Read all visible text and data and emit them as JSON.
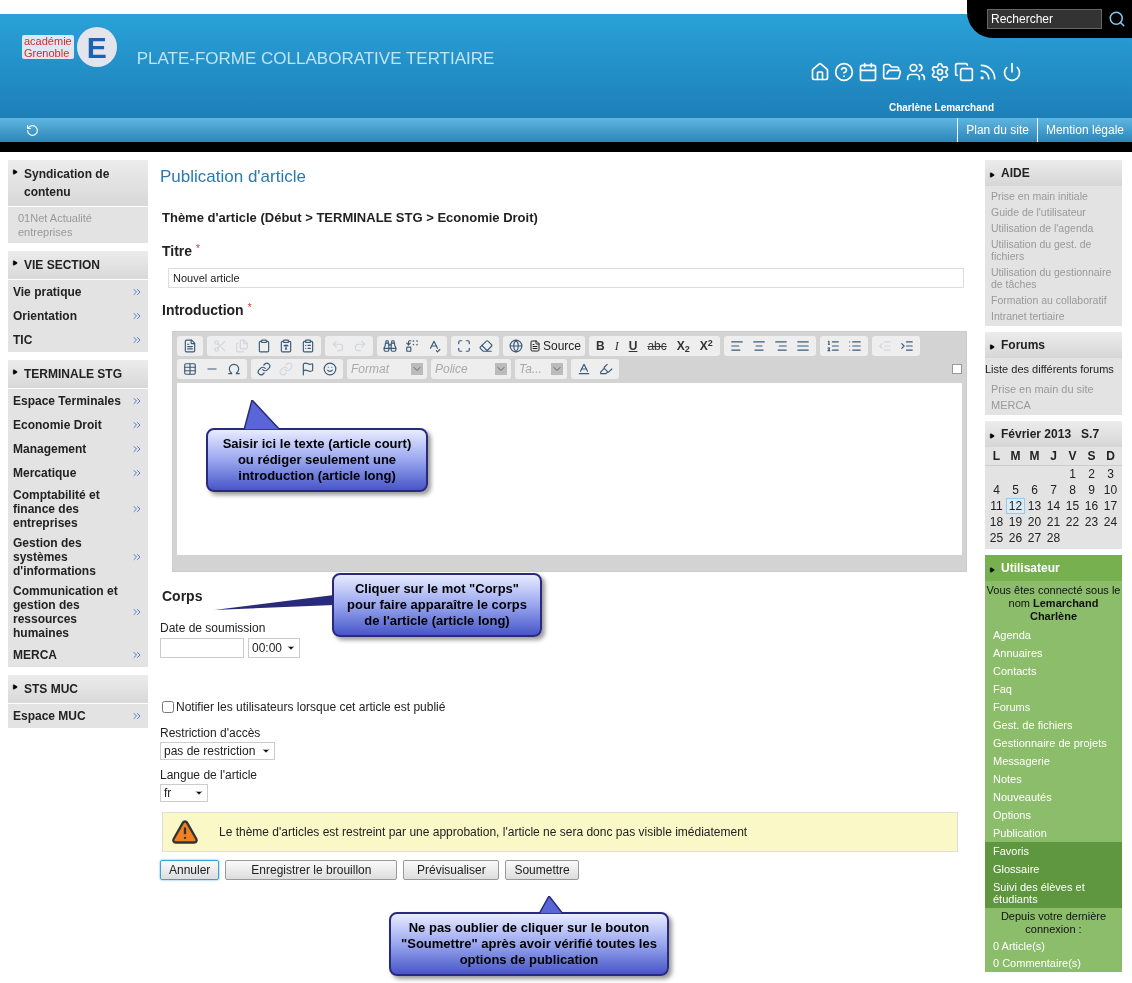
{
  "header": {
    "logo": {
      "line1": "académie",
      "line2": "Grenoble",
      "letter": "E"
    },
    "title": "PLATE-FORME COLLABORATIVE TERTIAIRE",
    "search": {
      "placeholder": "Rechercher"
    },
    "user": "Charlène Lemarchand",
    "links": [
      "Plan du site",
      "Mention légale"
    ]
  },
  "left_sidebar": [
    {
      "title": "Syndication de contenu",
      "kind": "feed",
      "items": [
        {
          "label": "01Net Actualité entreprises"
        }
      ]
    },
    {
      "title": "VIE SECTION",
      "kind": "nav",
      "items": [
        {
          "label": "Vie pratique"
        },
        {
          "label": "Orientation"
        },
        {
          "label": "TIC"
        }
      ]
    },
    {
      "title": "TERMINALE STG",
      "kind": "nav",
      "items": [
        {
          "label": "Espace Terminales"
        },
        {
          "label": "Economie Droit"
        },
        {
          "label": "Management"
        },
        {
          "label": "Mercatique"
        },
        {
          "label": "Comptabilité et finance des entreprises"
        },
        {
          "label": "Gestion des systèmes d'informations"
        },
        {
          "label": "Communication et gestion des ressources humaines"
        },
        {
          "label": "MERCA"
        }
      ]
    },
    {
      "title": "STS MUC",
      "kind": "nav",
      "items": [
        {
          "label": "Espace MUC"
        }
      ]
    }
  ],
  "main": {
    "title": "Publication d'article",
    "theme": "Thème d'article (Début > TERMINALE STG > Economie Droit)",
    "titre": {
      "label": "Titre",
      "required_mark": "*",
      "value": "Nouvel article"
    },
    "introduction": {
      "label": "Introduction",
      "required_mark": "*",
      "toolbar": {
        "source": "Source",
        "format_buttons": [
          "B",
          "I",
          "U",
          "abc",
          "X$_{2}$",
          "X$^{2}$"
        ],
        "combos": [
          {
            "placeholder": "Format"
          },
          {
            "placeholder": "Police"
          },
          {
            "placeholder": "Ta..."
          }
        ]
      }
    },
    "corps": {
      "label": "Corps"
    },
    "date": {
      "label": "Date de soumission",
      "time": "00:00"
    },
    "notify": {
      "label": "Notifier les utilisateurs lorsque cet article est publié",
      "checked": false
    },
    "restriction": {
      "label": "Restriction d'accès",
      "value": "pas de restriction"
    },
    "langue": {
      "label": "Langue de l'article",
      "value": "fr"
    },
    "warning": "Le thème d'articles est restreint par une approbation, l'article ne sera donc pas visible imédiatement",
    "buttons": [
      {
        "label": "Annuler",
        "selected": true
      },
      {
        "label": "Enregistrer le brouillon",
        "selected": false
      },
      {
        "label": "Prévisualiser",
        "selected": false
      },
      {
        "label": "Soumettre",
        "selected": false
      }
    ]
  },
  "callouts": [
    {
      "text": "Saisir ici le texte (article court) ou rédiger seulement une introduction (article long)"
    },
    {
      "text": "Cliquer sur le mot \"Corps\" pour faire apparaître le corps de l'article (article long)"
    },
    {
      "text": "Ne pas oublier de cliquer sur le bouton \"Soumettre\" après avoir vérifié toutes les options de publication"
    }
  ],
  "right_sidebar": {
    "aide": {
      "title": "AIDE",
      "items": [
        "Prise en main initiale",
        "Guide de l'utilisateur",
        "Utilisation de l'agenda",
        "Utilisation du gest. de fichiers",
        "Utilisation du gestionnaire de tâches",
        "Formation au collaboratif",
        "Intranet tertiaire"
      ]
    },
    "forums": {
      "title": "Forums",
      "intro": "Liste des différents forums",
      "items": [
        "Prise en main du site",
        "MERCA"
      ]
    },
    "calendar": {
      "title": "Février 2013",
      "week": "S.7",
      "weekdays": [
        "L",
        "M",
        "M",
        "J",
        "V",
        "S",
        "D"
      ],
      "weeks": [
        [
          {
            "day": "1",
            "selected": false
          },
          {
            "day": "2",
            "selected": false
          },
          {
            "day": "3",
            "selected": false
          }
        ],
        [
          {
            "day": "4",
            "selected": false
          },
          {
            "day": "5",
            "selected": false
          },
          {
            "day": "6",
            "selected": false
          },
          {
            "day": "7",
            "selected": false
          },
          {
            "day": "8",
            "selected": false
          },
          {
            "day": "9",
            "selected": false
          },
          {
            "day": "10",
            "selected": false
          }
        ],
        [
          {
            "day": "11",
            "selected": false
          },
          {
            "day": "12",
            "selected": true
          },
          {
            "day": "13",
            "selected": false
          },
          {
            "day": "14",
            "selected": false
          },
          {
            "day": "15",
            "selected": false
          },
          {
            "day": "16",
            "selected": false
          },
          {
            "day": "17",
            "selected": false
          }
        ],
        [
          {
            "day": "18",
            "selected": false
          },
          {
            "day": "19",
            "selected": false
          },
          {
            "day": "20",
            "selected": false
          },
          {
            "day": "21",
            "selected": false
          },
          {
            "day": "22",
            "selected": false
          },
          {
            "day": "23",
            "selected": false
          },
          {
            "day": "24",
            "selected": false
          }
        ],
        [
          {
            "day": "25",
            "selected": false
          },
          {
            "day": "26",
            "selected": false
          },
          {
            "day": "27",
            "selected": false
          },
          {
            "day": "28",
            "selected": false
          }
        ]
      ]
    },
    "user": {
      "title": "Utilisateur",
      "connected": "Vous êtes connecté sous le nom **Lemarchand Charlène**",
      "items": [
        {
          "label": "Agenda",
          "highlighted": false
        },
        {
          "label": "Annuaires",
          "highlighted": false
        },
        {
          "label": "Contacts",
          "highlighted": false
        },
        {
          "label": "Faq",
          "highlighted": false
        },
        {
          "label": "Forums",
          "highlighted": false
        },
        {
          "label": "Gest. de fichiers",
          "highlighted": false
        },
        {
          "label": "Gestionnaire de projets",
          "highlighted": false
        },
        {
          "label": "Messagerie",
          "highlighted": false
        },
        {
          "label": "Notes",
          "highlighted": false
        },
        {
          "label": "Nouveautés",
          "highlighted": false
        },
        {
          "label": "Options",
          "highlighted": false
        },
        {
          "label": "Publication",
          "highlighted": false
        },
        {
          "label": "Favoris",
          "highlighted": true
        },
        {
          "label": "Glossaire",
          "highlighted": true
        },
        {
          "label": "Suivi des élèves et étudiants",
          "highlighted": true
        }
      ],
      "since": "Depuis votre dernière connexion :",
      "counts": [
        "0 Article(s)",
        "0 Commentaire(s)"
      ]
    }
  }
}
